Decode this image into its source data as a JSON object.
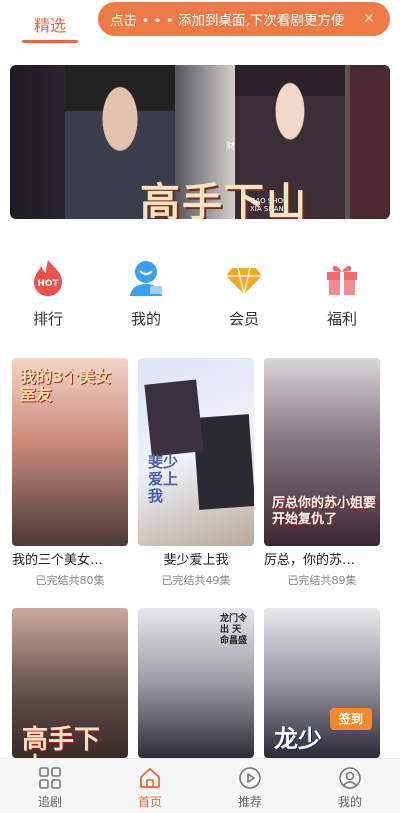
{
  "top_tabs": {
    "active": "精选"
  },
  "toast": {
    "text": "点击 • • • 添加到桌面,下次看剧更方便",
    "close_icon": "close-icon"
  },
  "banner": {
    "title": "高手下山",
    "subtitle_line1": "GAO SHOU",
    "subtitle_line2": "XIA SHAN",
    "tag": "财"
  },
  "menu": [
    {
      "label": "排行",
      "icon": "hot-flame-icon",
      "badge": "HOT",
      "color": "#f0504a"
    },
    {
      "label": "我的",
      "icon": "user-icon",
      "color": "#3aa0f5"
    },
    {
      "label": "会员",
      "icon": "diamond-icon",
      "color": "#f5a623"
    },
    {
      "label": "福利",
      "icon": "gift-icon",
      "color": "#f06a72"
    }
  ],
  "dramas": [
    {
      "title": "我的三个美女…",
      "status": "已完结共80集",
      "poster_text": "我的3个美女室友"
    },
    {
      "title": "斐少爱上我",
      "status": "已完结共49集",
      "poster_text": "斐少爱上我"
    },
    {
      "title": "厉总，你的苏…",
      "status": "已完结共89集",
      "poster_text": "厉总你的苏小姐要开始复仇了"
    },
    {
      "title": "",
      "status": "",
      "poster_text": "高手下山"
    },
    {
      "title": "",
      "status": "",
      "poster_text": "龙门令出 天命昌盛"
    },
    {
      "title": "",
      "status": "",
      "poster_text": "龙少",
      "badge": "签到"
    }
  ],
  "bottom_nav": [
    {
      "label": "追剧",
      "icon": "grid-icon"
    },
    {
      "label": "首页",
      "icon": "home-icon",
      "active": true
    },
    {
      "label": "推荐",
      "icon": "play-icon"
    },
    {
      "label": "我的",
      "icon": "profile-icon"
    }
  ],
  "colors": {
    "accent": "#e8683e",
    "toast_bg": "#f07a46"
  }
}
